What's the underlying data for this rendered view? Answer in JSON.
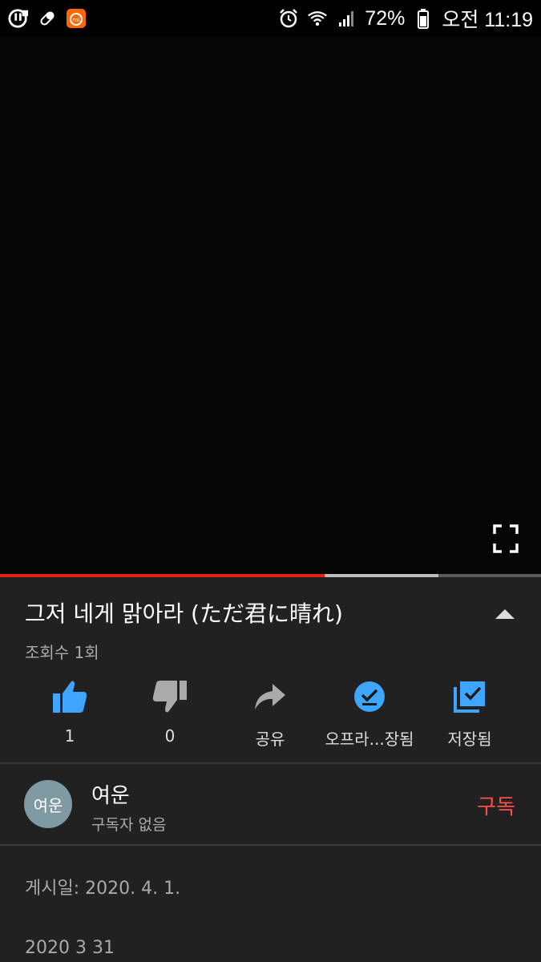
{
  "status_bar": {
    "battery": "72%",
    "time": "오전 11:19",
    "left_icons": [
      "u-plus-icon",
      "pill-icon",
      "mi-app-icon"
    ],
    "right_icons": [
      "alarm-icon",
      "wifi-icon",
      "signal-icon",
      "battery-icon"
    ]
  },
  "player": {
    "progress_played": 0.6,
    "progress_buffered": 0.81,
    "progress_color": "#e62117",
    "fullscreen_icon": "fullscreen-icon"
  },
  "video": {
    "title": "그저 네게 맑아라 (ただ君に晴れ)",
    "views": "조회수 1회"
  },
  "actions": {
    "like": {
      "icon": "thumbs-up-icon",
      "label": "1",
      "color": "#3ea6ff"
    },
    "dislike": {
      "icon": "thumbs-down-icon",
      "label": "0"
    },
    "share": {
      "icon": "share-icon",
      "label": "공유"
    },
    "offline": {
      "icon": "download-done-icon",
      "label": "오프라...장됨",
      "color": "#3ea6ff"
    },
    "save": {
      "icon": "playlist-saved-icon",
      "label": "저장됨",
      "color": "#3ea6ff"
    }
  },
  "channel": {
    "avatar_text": "여운",
    "avatar_color": "#7f9aa3",
    "name": "여운",
    "subscribers": "구독자 없음",
    "subscribe_label": "구독",
    "subscribe_color": "#ff4e45"
  },
  "description": {
    "published": "게시일: 2020. 4. 1.",
    "body": "2020 3 31"
  }
}
